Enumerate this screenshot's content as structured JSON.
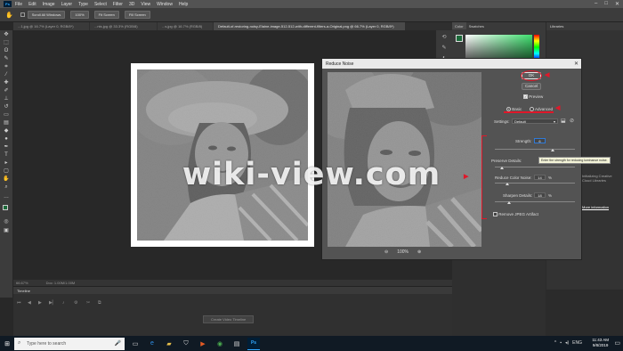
{
  "menu": {
    "items": [
      "File",
      "Edit",
      "Image",
      "Layer",
      "Type",
      "Select",
      "Filter",
      "3D",
      "View",
      "Window",
      "Help"
    ],
    "app_logo": "Ps",
    "window_controls": [
      "minimize-icon",
      "maximize-icon",
      "close-icon"
    ]
  },
  "options": {
    "scroll_all_label": "Scroll All Windows",
    "zoom_value": "100%",
    "fit_screen": "Fit Screen",
    "fill_screen": "Fill Screen"
  },
  "tabs": [
    {
      "label": "...1.jpg @ 16.7% (Layer 0, RGB/8*)",
      "active": false
    },
    {
      "label": "...nts.jpg @ 33.3% (RGB/8)",
      "active": false
    },
    {
      "label": "...s.jpg @ 16.7% (RGB/8)",
      "active": false
    },
    {
      "label": "Default-of-restoring-noisy-Elaine-image-512-512-with-different-filters-a-Original.png @ 66.7% (Layer 0, RGB/8*)",
      "active": true
    }
  ],
  "status": {
    "zoom": "66.67%",
    "doc": "Doc: 1.00M/1.00M"
  },
  "timeline": {
    "title": "Timeline",
    "create_video_label": "Create Video Timeline"
  },
  "color_panel": {
    "tabs": [
      "Color",
      "Swatches"
    ],
    "fg_color": "#1c6a3a"
  },
  "libraries_panel": {
    "title": "Libraries",
    "initializing_text": "Initializing Creative Cloud Libraries",
    "more_info_link": "More information"
  },
  "dialog": {
    "title": "Reduce Noise",
    "ok_label": "OK",
    "cancel_label": "Cancel",
    "preview_label": "Preview",
    "preview_checked": true,
    "mode_basic": "Basic",
    "mode_advanced": "Advanced",
    "mode_selected": "Basic",
    "settings_label": "Settings:",
    "settings_value": "Default",
    "strength_label": "Strength:",
    "strength_value": "6",
    "preserve_label": "Preserve Details:",
    "preserve_value": "60",
    "reduce_color_label": "Reduce Color Noise:",
    "reduce_color_value": "14",
    "sharpen_label": "Sharpen Details:",
    "sharpen_value": "18",
    "percent": "%",
    "jpeg_label": "Remove JPEG Artifact",
    "jpeg_checked": false,
    "zoom_value": "100%",
    "tooltip": "Enter the strength for reducing luminance noise."
  },
  "watermark": "wiki-view.com",
  "taskbar": {
    "search_placeholder": "Type here to search",
    "time": "11:43 AM",
    "date": "9/8/2019",
    "lang": "ENG"
  },
  "accent": "#e0182a"
}
